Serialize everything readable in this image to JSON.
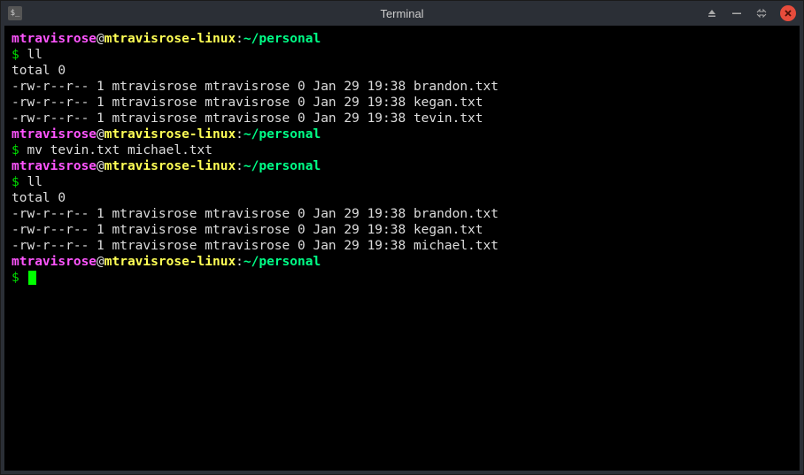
{
  "window": {
    "title": "Terminal",
    "icon_label": "$_"
  },
  "prompt": {
    "user": "mtravisrose",
    "at": "@",
    "host": "mtravisrose-linux",
    "colon": ":",
    "path": "~/personal",
    "symbol": "$"
  },
  "session": [
    {
      "type": "prompt"
    },
    {
      "type": "cmd",
      "text": "ll"
    },
    {
      "type": "out",
      "text": "total 0"
    },
    {
      "type": "out",
      "text": "-rw-r--r-- 1 mtravisrose mtravisrose 0 Jan 29 19:38 brandon.txt"
    },
    {
      "type": "out",
      "text": "-rw-r--r-- 1 mtravisrose mtravisrose 0 Jan 29 19:38 kegan.txt"
    },
    {
      "type": "out",
      "text": "-rw-r--r-- 1 mtravisrose mtravisrose 0 Jan 29 19:38 tevin.txt"
    },
    {
      "type": "prompt"
    },
    {
      "type": "cmd",
      "text": "mv tevin.txt michael.txt"
    },
    {
      "type": "prompt"
    },
    {
      "type": "cmd",
      "text": "ll"
    },
    {
      "type": "out",
      "text": "total 0"
    },
    {
      "type": "out",
      "text": "-rw-r--r-- 1 mtravisrose mtravisrose 0 Jan 29 19:38 brandon.txt"
    },
    {
      "type": "out",
      "text": "-rw-r--r-- 1 mtravisrose mtravisrose 0 Jan 29 19:38 kegan.txt"
    },
    {
      "type": "out",
      "text": "-rw-r--r-- 1 mtravisrose mtravisrose 0 Jan 29 19:38 michael.txt"
    },
    {
      "type": "prompt"
    },
    {
      "type": "cursor"
    }
  ]
}
